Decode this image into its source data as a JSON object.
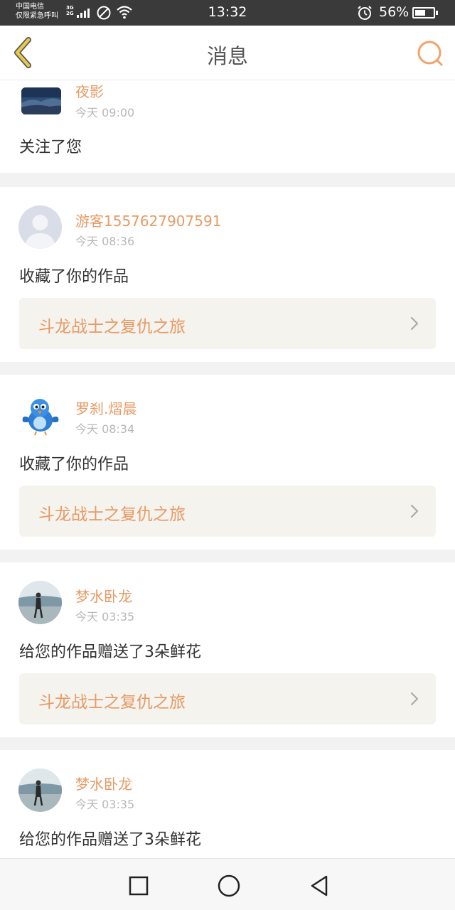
{
  "status_bar": {
    "carrier_line1": "中国电信",
    "carrier_line2": "仅限紧急呼叫",
    "network_1": "3G",
    "network_2": "2G",
    "time": "13:32",
    "battery": "56%"
  },
  "header": {
    "title": "消息",
    "back_icon": "chevron-left-icon",
    "search_icon": "search-icon"
  },
  "colors": {
    "accent": "#e89a64",
    "back_arrow": "#e8c84a",
    "status_bar": "#3a3a3a"
  },
  "messages": [
    {
      "user": "夜影",
      "time": "今天 09:00",
      "action": "关注了您",
      "work": ""
    },
    {
      "user": "游客1557627907591",
      "time": "今天 08:36",
      "action": "收藏了你的作品",
      "work": "斗龙战士之复仇之旅"
    },
    {
      "user": "罗刹.熠晨",
      "time": "今天 08:34",
      "action": "收藏了你的作品",
      "work": "斗龙战士之复仇之旅"
    },
    {
      "user": "梦水卧龙",
      "time": "今天 03:35",
      "action": "给您的作品赠送了3朵鲜花",
      "work": "斗龙战士之复仇之旅"
    },
    {
      "user": "梦水卧龙",
      "time": "今天 03:35",
      "action": "给您的作品赠送了3朵鲜花",
      "work": ""
    }
  ],
  "system_nav": {
    "recent_icon": "square-icon",
    "home_icon": "circle-icon",
    "back_icon": "triangle-back-icon"
  }
}
